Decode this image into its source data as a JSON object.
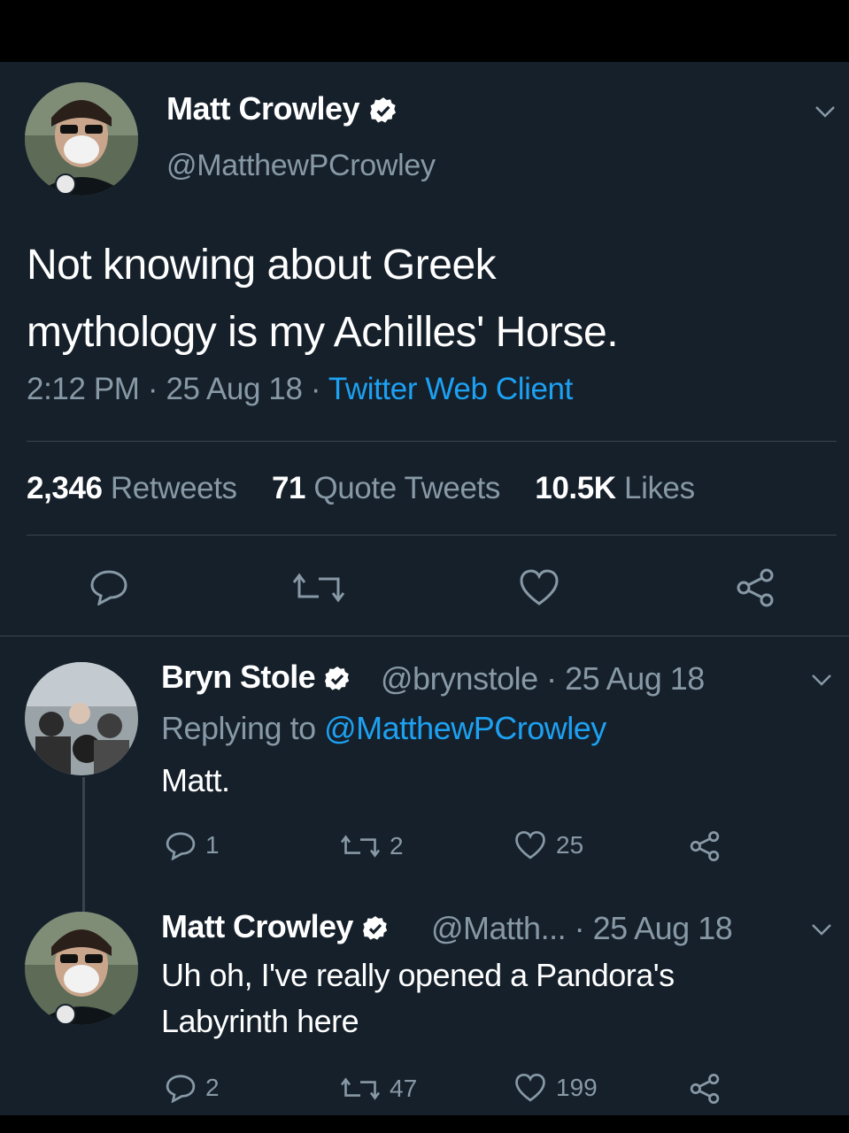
{
  "colors": {
    "background": "#15202b",
    "secondary_text": "#8899a6",
    "accent": "#1da1f2",
    "divider": "#38444d"
  },
  "main_tweet": {
    "author_name": "Matt Crowley",
    "handle": "@MatthewPCrowley",
    "text_line1": "Not knowing about Greek",
    "text_line2": "mythology is my Achilles' Horse.",
    "time": "2:12 PM",
    "date": "25 Aug 18",
    "client": "Twitter Web Client",
    "retweets_count": "2,346",
    "retweets_label": "Retweets",
    "quotes_count": "71",
    "quotes_label": "Quote Tweets",
    "likes_count": "10.5K",
    "likes_label": "Likes"
  },
  "replies": [
    {
      "author_name": "Bryn Stole",
      "handle": "@brynstole",
      "date": "25 Aug 18",
      "replying_prefix": "Replying to",
      "replying_to": "@MatthewPCrowley",
      "text_line1": "Matt.",
      "reply_count": "1",
      "retweet_count": "2",
      "like_count": "25"
    },
    {
      "author_name": "Matt Crowley",
      "handle": "@Matth...",
      "date": "25 Aug 18",
      "text_line1": "Uh oh, I've really opened a Pandora's",
      "text_line2": "Labyrinth here",
      "reply_count": "2",
      "retweet_count": "47",
      "like_count": "199"
    }
  ],
  "icons": [
    "verified-badge-icon",
    "chevron-down-icon",
    "reply-icon",
    "retweet-icon",
    "like-icon",
    "share-icon"
  ]
}
